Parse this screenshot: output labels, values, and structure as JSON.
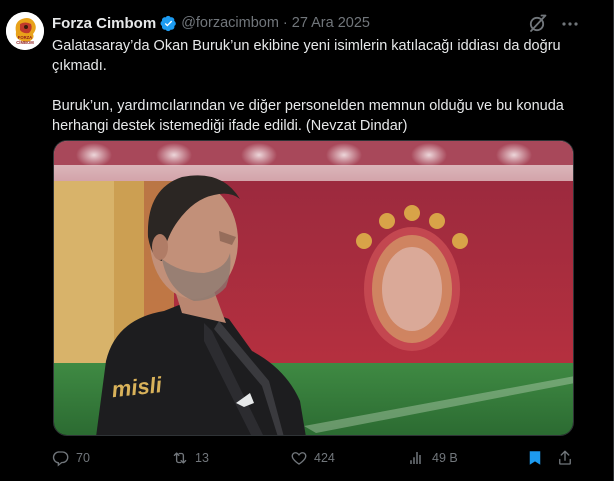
{
  "post": {
    "author_name": "Forza Cimbom",
    "handle": "@forzacimbom",
    "separator": "·",
    "date": "27 Ara 2025",
    "verified": true,
    "paragraphs": [
      "Galatasaray’da Okan Buruk’un ekibine yeni isimlerin katılacağı iddiası da doğru çıkmadı.",
      "Buruk’un, yardımcılarından ve diğer personelden memnun olduğu ve bu konuda herhangi destek istemediği ifade edildi. (Nevzat Dindar)"
    ],
    "media": {
      "shirt_text": "misli"
    }
  },
  "avatar": {
    "text_lines": [
      "FORZA",
      "CİMBOM"
    ]
  },
  "actions": {
    "replies": "70",
    "reposts": "13",
    "likes": "424",
    "views": "49 B"
  },
  "icons": {
    "verified": "verified-badge-icon",
    "grok": "grok-icon",
    "more": "more-icon",
    "reply": "reply-icon",
    "repost": "repost-icon",
    "like": "heart-icon",
    "views": "views-icon",
    "bookmark": "bookmark-icon",
    "share": "share-icon"
  },
  "colors": {
    "background": "#000000",
    "text": "#e7e9ea",
    "muted": "#71767b",
    "accent": "#1d9bf0"
  }
}
